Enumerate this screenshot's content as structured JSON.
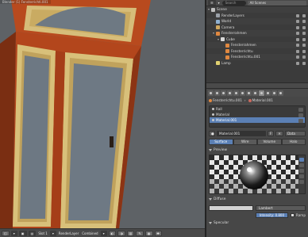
{
  "viewport": {
    "title_prefix": "Blender",
    "title": "(1) Fensterrichti.001"
  },
  "viewport_header": {
    "slot": "Slot 1",
    "render_layer": "RenderLayer",
    "pass": "Combined"
  },
  "outliner": {
    "search_placeholder": "Search",
    "display_mode": "All Scenes",
    "rows": [
      {
        "label": "Scene",
        "indent": 0,
        "icon_color": "#c0c0c0"
      },
      {
        "label": "RenderLayers",
        "indent": 1,
        "icon_color": "#9aa0a8"
      },
      {
        "label": "World",
        "indent": 1,
        "icon_color": "#8fb0d0"
      },
      {
        "label": "Camera",
        "indent": 1,
        "icon_color": "#d0a860"
      },
      {
        "label": "Fensterrahmen",
        "indent": 1,
        "icon_color": "#e08840"
      },
      {
        "label": "Cube",
        "indent": 2,
        "icon_color": "#d8d8d8"
      },
      {
        "label": "Fensterrahmen",
        "indent": 3,
        "icon_color": "#e08840"
      },
      {
        "label": "Fensterrichtu",
        "indent": 3,
        "icon_color": "#e08840"
      },
      {
        "label": "Fensterrichtu.001",
        "indent": 3,
        "icon_color": "#e08840"
      },
      {
        "label": "Lamp",
        "indent": 1,
        "icon_color": "#e0d070"
      }
    ]
  },
  "properties": {
    "breadcrumb": [
      "Fensterrichtu.001",
      "Material.001"
    ],
    "slots": [
      "Rall",
      "Material",
      "Material.001"
    ],
    "selected_slot": "Material.001",
    "material_name": "Material.001",
    "material_flag": "F",
    "data_select": "Data",
    "shading_tabs": [
      "Surface",
      "Wire",
      "Volume",
      "Halo"
    ],
    "active_shading_tab": "Surface",
    "preview_label": "Preview",
    "diffuse_label": "Diffuse",
    "diffuse_shader": "Lambert",
    "intensity": "Intensity: 0.800",
    "ramp_label": "Ramp",
    "specular_label": "Specular"
  },
  "colors": {
    "selection": "#5b80b5",
    "frame_wood": "#b84a1e",
    "trim": "#d8c07a",
    "glass": "#6f7a84"
  }
}
